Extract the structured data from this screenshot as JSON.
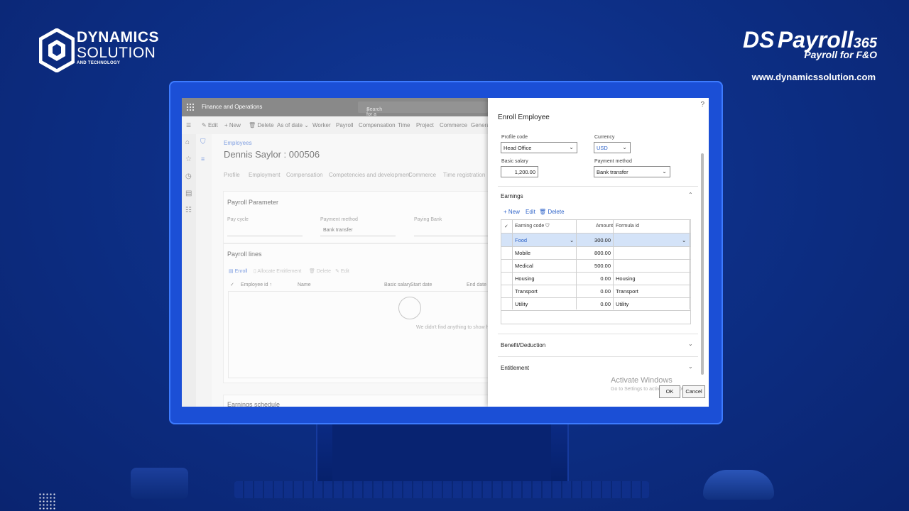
{
  "branding": {
    "company_line1": "DYNAMICS",
    "company_line2": "SOLUTION",
    "company_line3": "AND TECHNOLOGY",
    "product_ds": "DS",
    "product_name": "Payroll",
    "product_num": "365",
    "product_sub": "Payroll for F&O",
    "website": "www.dynamicssolution.com"
  },
  "app": {
    "title": "Finance and Operations",
    "search_placeholder": "Search for a page",
    "actions": [
      "Edit",
      "New",
      "Delete",
      "As of date",
      "Worker",
      "Payroll",
      "Compensation",
      "Time",
      "Project",
      "Commerce",
      "General"
    ],
    "breadcrumb": "Employees",
    "employee_title": "Dennis Saylor : 000506",
    "tabs": [
      "Profile",
      "Employment",
      "Compensation",
      "Competencies and development",
      "Commerce",
      "Time registration"
    ],
    "payroll_parameter": {
      "title": "Payroll Parameter",
      "pay_cycle_label": "Pay cycle",
      "payment_method_label": "Payment method",
      "payment_method_value": "Bank transfer",
      "paying_bank_label": "Paying Bank"
    },
    "payroll_lines": {
      "title": "Payroll lines",
      "toolbar": [
        "Enroll",
        "Allocate Entitlement",
        "Delete",
        "Edit"
      ],
      "columns": [
        "Employee id",
        "Name",
        "Basic salary",
        "Start date",
        "End date"
      ],
      "empty_text": "We didn't find anything to show here."
    },
    "earnings_schedule": "Earnings schedule"
  },
  "dialog": {
    "title": "Enroll Employee",
    "help": "?",
    "profile_code_label": "Profile code",
    "profile_code_value": "Head Office",
    "currency_label": "Currency",
    "currency_value": "USD",
    "basic_salary_label": "Basic salary",
    "basic_salary_value": "1,200.00",
    "payment_method_label": "Payment method",
    "payment_method_value": "Bank transfer",
    "earnings_title": "Earnings",
    "earnings_toolbar": {
      "new": "New",
      "edit": "Edit",
      "delete": "Delete"
    },
    "earnings_columns": {
      "code": "Earning code",
      "amount": "Amount",
      "formula": "Formula id"
    },
    "earnings_rows": [
      {
        "code": "Food",
        "amount": "300.00",
        "formula": ""
      },
      {
        "code": "Mobile",
        "amount": "800.00",
        "formula": ""
      },
      {
        "code": "Medical",
        "amount": "500.00",
        "formula": ""
      },
      {
        "code": "Housing",
        "amount": "0.00",
        "formula": "Housing"
      },
      {
        "code": "Transport",
        "amount": "0.00",
        "formula": "Transport"
      },
      {
        "code": "Utility",
        "amount": "0.00",
        "formula": "Utility"
      }
    ],
    "benefit_title": "Benefit/Deduction",
    "entitlement_title": "Entitlement",
    "ok_label": "OK",
    "cancel_label": "Cancel"
  },
  "watermark": {
    "line1": "Activate Windows",
    "line2": "Go to Settings to activate Windows."
  }
}
